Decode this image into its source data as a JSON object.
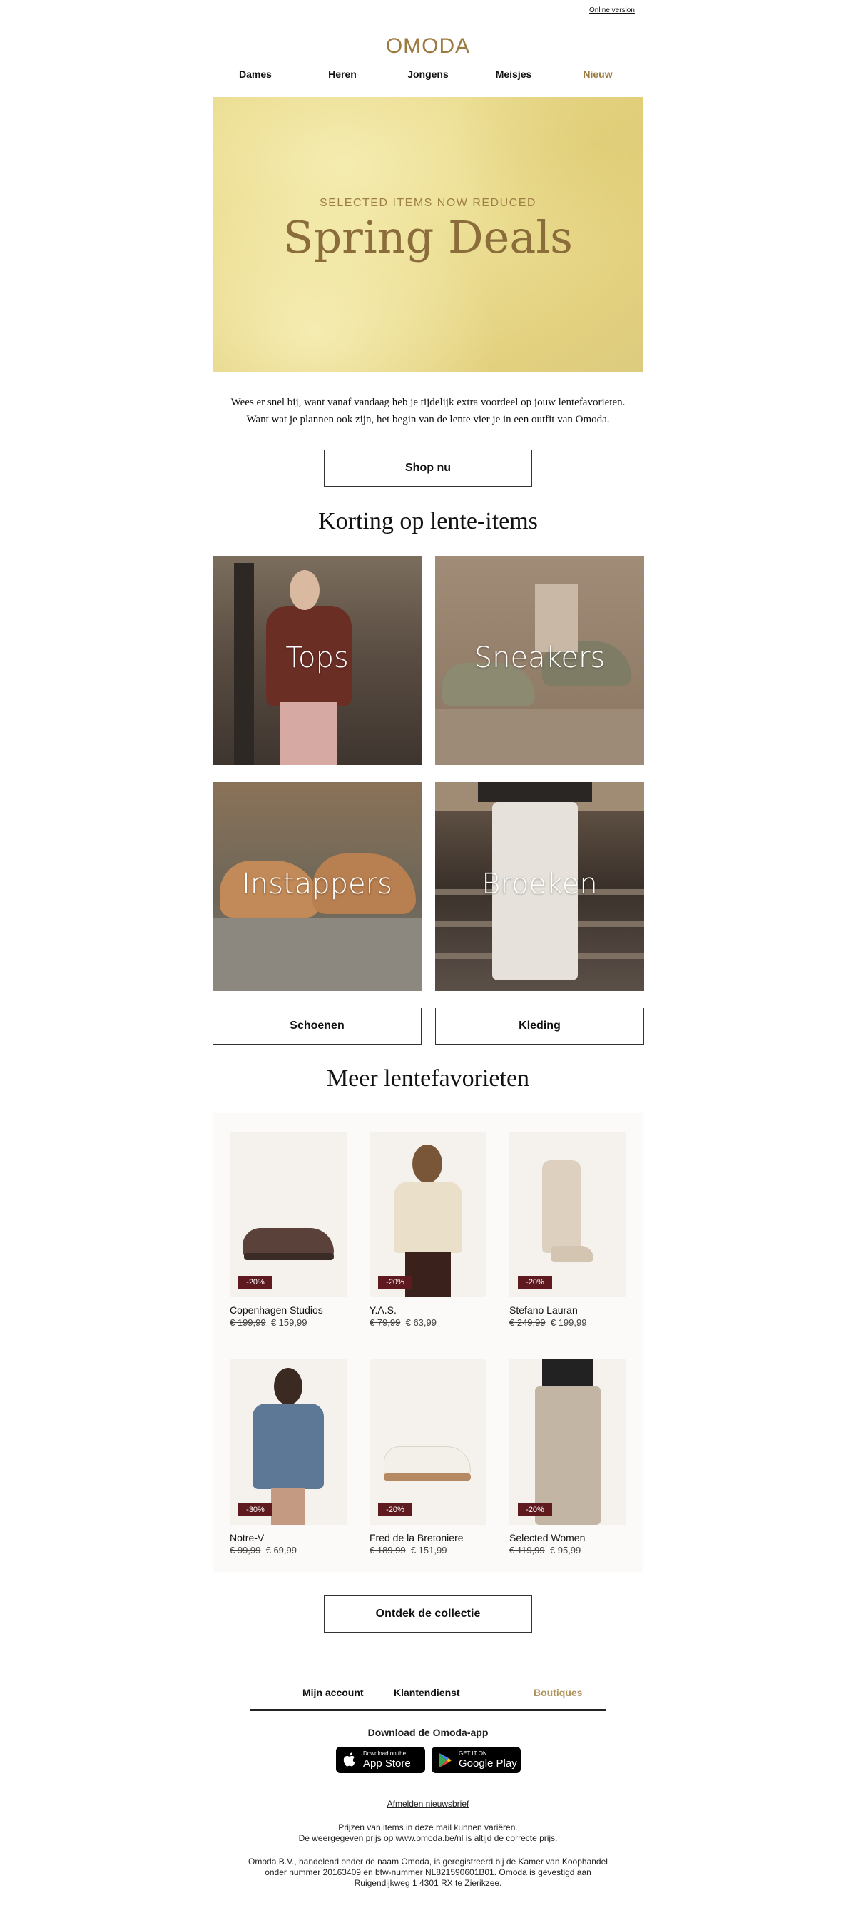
{
  "header": {
    "online_version": "Online version",
    "logo_text": "OMODA",
    "brand_color": "#9b7b3f"
  },
  "nav": [
    "Dames",
    "Heren",
    "Jongens",
    "Meisjes",
    "Nieuw"
  ],
  "hero": {
    "kicker": "SELECTED ITEMS NOW REDUCED",
    "title": "Spring Deals"
  },
  "intro": {
    "line1": "Wees er snel bij, want vanaf vandaag heb je tijdelijk extra voordeel op jouw lentefavorieten.",
    "line2": "Want wat je plannen ook zijn, het begin van de lente vier je in een outfit van Omoda."
  },
  "cta_shop": "Shop nu",
  "section1_title": "Korting op lente-items",
  "categories": [
    "Tops",
    "Sneakers",
    "Instappers",
    "Broeken"
  ],
  "cta_shoes": "Schoenen",
  "cta_clothing": "Kleding",
  "section2_title": "Meer lentefavorieten",
  "products": [
    {
      "brand": "Copenhagen Studios",
      "old_price": "€ 199,99",
      "new_price": "€ 159,99",
      "discount": "-20%"
    },
    {
      "brand": "Y.A.S.",
      "old_price": "€ 79,99",
      "new_price": "€ 63,99",
      "discount": "-20%"
    },
    {
      "brand": "Stefano Lauran",
      "old_price": "€ 249,99",
      "new_price": "€ 199,99",
      "discount": "-20%"
    },
    {
      "brand": "Notre-V",
      "old_price": "€ 99,99",
      "new_price": "€ 69,99",
      "discount": "-30%"
    },
    {
      "brand": "Fred de la Bretoniere",
      "old_price": "€ 189,99",
      "new_price": "€ 151,99",
      "discount": "-20%"
    },
    {
      "brand": "Selected Women",
      "old_price": "€ 119,99",
      "new_price": "€ 95,99",
      "discount": "-20%"
    }
  ],
  "cta_collection": "Ontdek de collectie",
  "footer": {
    "links": [
      "Mijn account",
      "Klantendienst",
      "Boutiques"
    ],
    "app_title": "Download de Omoda-app",
    "apple_small": "Download on the",
    "apple_big": "App Store",
    "google_small": "GET IT ON",
    "google_big": "Google Play",
    "unsubscribe": "Afmelden nieuwsbrief",
    "legal1_a": "Prijzen van items in deze mail kunnen variëren.",
    "legal1_b": "De weergegeven prijs op www.omoda.be/nl is altijd de correcte prijs.",
    "legal2_a": "Omoda B.V., handelend onder de naam Omoda, is geregistreerd bij de Kamer van Koophandel",
    "legal2_b": "onder nummer 20163409 en btw-nummer NL821590601B01. Omoda is gevestigd aan",
    "legal2_c": "Ruigendijkweg 1 4301 RX te Zierikzee."
  }
}
